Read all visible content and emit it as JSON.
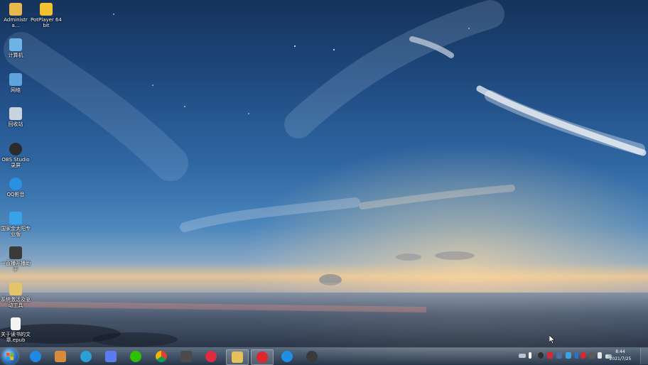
{
  "desktop": {
    "icons": [
      {
        "label": "Administra...",
        "icon": "folder-icon",
        "color": "#e9b84a"
      },
      {
        "label": "PotPlayer 64 bit",
        "icon": "potplayer-icon",
        "color": "#f2c230"
      },
      {
        "label": "计算机",
        "icon": "computer-icon",
        "color": "#6fb2e6"
      },
      {
        "label": "网络",
        "icon": "network-icon",
        "color": "#5fa3dc"
      },
      {
        "label": "回收站",
        "icon": "recycle-bin-icon",
        "color": "#c9d4de"
      },
      {
        "label": "OBS Studio录屏",
        "icon": "obs-icon",
        "color": "#2b2b2b"
      },
      {
        "label": "QQ影音",
        "icon": "qq-player-icon",
        "color": "#2a90e0"
      },
      {
        "label": "国家金太阳专业版",
        "icon": "sun-edu-icon",
        "color": "#3aa2e8"
      },
      {
        "label": "一直播开播助手",
        "icon": "live-assistant-icon",
        "color": "#3a3a3a"
      },
      {
        "label": "系统激活及驱动工具",
        "icon": "activation-tool-icon",
        "color": "#e3c46a"
      },
      {
        "label": "关于读书的文章.epub",
        "icon": "document-icon",
        "color": "#f4f4f4"
      }
    ]
  },
  "taskbar": {
    "apps": [
      {
        "name": "internet-explorer",
        "icon": "ie-icon",
        "color": "#1e88e5",
        "active": false
      },
      {
        "name": "library",
        "icon": "library-books-icon",
        "color": "#d68a3a",
        "active": false
      },
      {
        "name": "app-cloud",
        "icon": "cloud-app-icon",
        "color": "#2aa0d8",
        "active": false
      },
      {
        "name": "feishu",
        "icon": "bird-app-icon",
        "color": "#5a7cf0",
        "active": false
      },
      {
        "name": "wechat",
        "icon": "wechat-icon",
        "color": "#2dc100",
        "active": false
      },
      {
        "name": "chrome",
        "icon": "chrome-icon",
        "color": "#e8b01a",
        "active": false
      },
      {
        "name": "editor",
        "icon": "editor-icon",
        "color": "#4a4a4a",
        "active": false
      },
      {
        "name": "recorder",
        "icon": "record-icon",
        "color": "#e02a40",
        "active": false
      },
      {
        "name": "file-explorer",
        "icon": "folder-explorer-icon",
        "color": "#e6c15a",
        "active": true
      },
      {
        "name": "netease-music",
        "icon": "netease-music-icon",
        "color": "#e0262d",
        "active": true
      },
      {
        "name": "browser-blue",
        "icon": "browser-blue-icon",
        "color": "#1f8fe6",
        "active": false
      },
      {
        "name": "obs",
        "icon": "obs-taskbar-icon",
        "color": "#3a3a3a",
        "active": false
      }
    ],
    "tray_icons": [
      {
        "name": "keyboard-tray-icon",
        "color": "#b9c4cf"
      },
      {
        "name": "flag-tray-icon",
        "color": "#ffffff"
      },
      {
        "name": "obs-tray-icon",
        "color": "#2e2e2e"
      },
      {
        "name": "antivirus-tray-icon",
        "color": "#d02a3a"
      },
      {
        "name": "shield-tray-icon",
        "color": "#4a6fa0"
      },
      {
        "name": "cloud-tray-icon",
        "color": "#3fa2e0"
      },
      {
        "name": "bluetooth-tray-icon",
        "color": "#2b6fd0"
      },
      {
        "name": "netease-tray-icon",
        "color": "#e0262d"
      },
      {
        "name": "media-tray-icon",
        "color": "#5a5a5a"
      },
      {
        "name": "volume-tray-icon",
        "color": "#e6e6e6"
      },
      {
        "name": "network-signal-tray-icon",
        "color": "#e6e6e6"
      }
    ],
    "clock": {
      "time": "8:44",
      "date": "2021/7/25"
    }
  }
}
